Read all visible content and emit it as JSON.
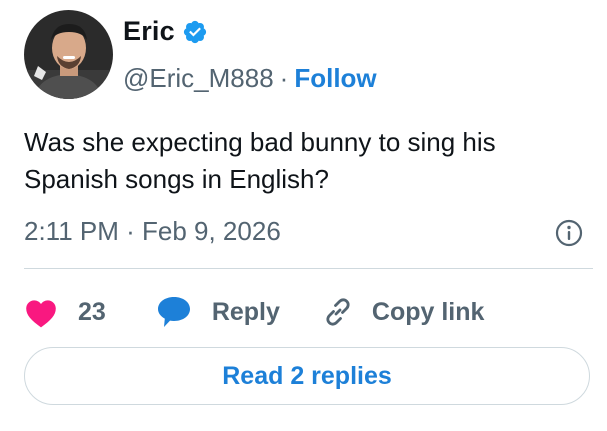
{
  "author": {
    "display_name": "Eric",
    "handle": "@Eric_M888",
    "separator": "·",
    "follow_label": "Follow"
  },
  "tweet": {
    "text": "Was she expecting bad bunny to sing his Spanish songs in English?",
    "timestamp": "2:11 PM · Feb 9, 2026"
  },
  "actions": {
    "like_count": "23",
    "reply_label": "Reply",
    "copy_link_label": "Copy link"
  },
  "footer": {
    "read_replies_label": "Read 2 replies"
  },
  "colors": {
    "accent": "#1d80d8",
    "like": "#f91880",
    "secondary_text": "#536471",
    "verified": "#1d9bf0"
  }
}
